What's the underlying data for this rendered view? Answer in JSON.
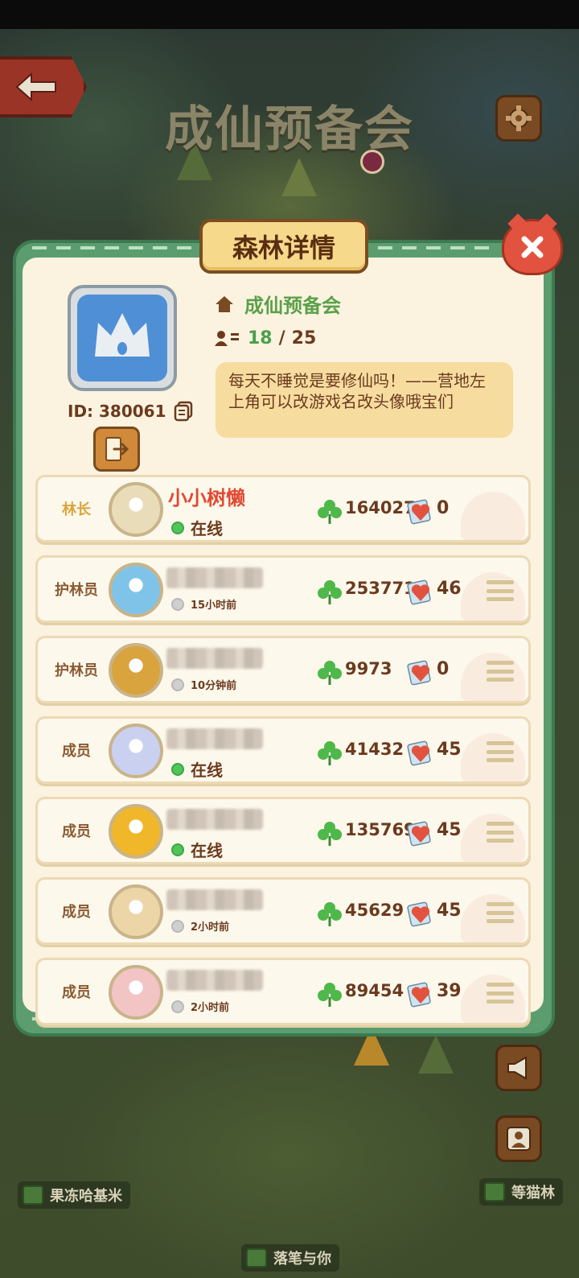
{
  "background": {
    "title": "成仙预备会",
    "places": [
      {
        "label": "果冻哈基米"
      },
      {
        "label": "等猫林"
      },
      {
        "label": "落笔与你"
      }
    ]
  },
  "dialog": {
    "title": "森林详情",
    "guild": {
      "name": "成仙预备会",
      "id_label": "ID: 380061",
      "members_current": "18",
      "members_sep": "/",
      "members_max": "25",
      "announcement": "每天不睡觉是要修仙吗！——营地左上角可以改游戏名改头像哦宝们"
    },
    "members": [
      {
        "role": "林长",
        "name": "小小树懒",
        "status": "在线",
        "online": true,
        "score": "164027",
        "likes": "0",
        "avatar_color": "#e9dcb8"
      },
      {
        "role": "护林员",
        "name": "",
        "status": "15小时前",
        "online": false,
        "score": "253771",
        "likes": "46",
        "avatar_color": "#7fc4e8"
      },
      {
        "role": "护林员",
        "name": "",
        "status": "10分钟前",
        "online": false,
        "score": "9973",
        "likes": "0",
        "avatar_color": "#d9a43e"
      },
      {
        "role": "成员",
        "name": "",
        "status": "在线",
        "online": true,
        "score": "41432",
        "likes": "45",
        "avatar_color": "#c9d0f0"
      },
      {
        "role": "成员",
        "name": "",
        "status": "在线",
        "online": true,
        "score": "135769",
        "likes": "45",
        "avatar_color": "#f0b72a"
      },
      {
        "role": "成员",
        "name": "",
        "status": "2小时前",
        "online": false,
        "score": "45629",
        "likes": "45",
        "avatar_color": "#ecd6a8"
      },
      {
        "role": "成员",
        "name": "",
        "status": "2小时前",
        "online": false,
        "score": "89454",
        "likes": "39",
        "avatar_color": "#f2c4c4"
      }
    ]
  },
  "colors": {
    "panel_green": "#5b9d6e",
    "accent_orange": "#d08a3a",
    "close_red": "#e2533f",
    "online_green": "#4fc55a"
  }
}
